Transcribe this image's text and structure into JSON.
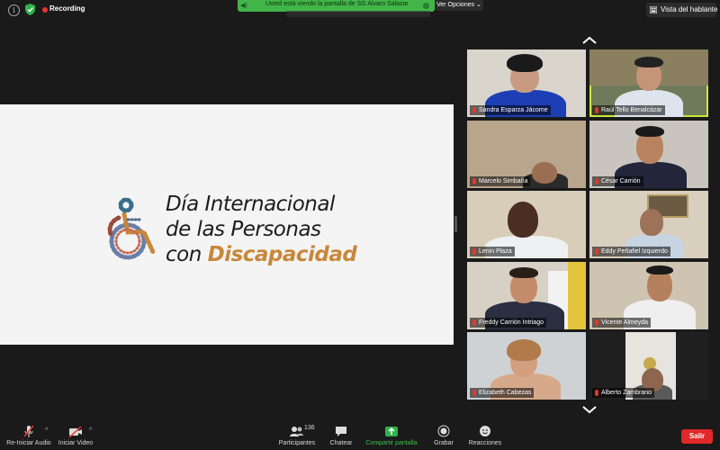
{
  "top_bar": {
    "recording_label": "Recording",
    "share_banner": "Usted está viendo la pantalla de SG Alvaro Salazar",
    "view_options": "Ver Opciones",
    "speaker_view": "Vista del hablante"
  },
  "shared_screen": {
    "line1": "Día Internacional",
    "line2": "de las Personas",
    "line3_prefix": "con ",
    "line3_highlight": "Discapacidad"
  },
  "participants": [
    {
      "name": "Sandra Esparza Jácome"
    },
    {
      "name": "Raúl Tello Benalcázar"
    },
    {
      "name": "Marcelo Simbaña"
    },
    {
      "name": "César Carrión"
    },
    {
      "name": "Lenin Plaza"
    },
    {
      "name": "Eddy Peñafiel Izquierdo"
    },
    {
      "name": "Freddy Carrión Intriago"
    },
    {
      "name": "Vicente Almeyda"
    },
    {
      "name": "Elizabeth Cabezas"
    },
    {
      "name": "Alberto Zambrano"
    }
  ],
  "toolbar": {
    "audio_label": "Re-Iniciar Audio",
    "video_label": "Iniciar Video",
    "participants_label": "Participantes",
    "participants_count": "136",
    "chat_label": "Chatear",
    "share_label": "Compartir pantalla",
    "record_label": "Grabar",
    "reactions_label": "Reacciones",
    "leave_label": "Salir"
  },
  "colors": {
    "accent_green": "#42b549",
    "active_speaker": "#c8e63c",
    "leave_red": "#e02828",
    "highlight_orange": "#c8873a"
  }
}
